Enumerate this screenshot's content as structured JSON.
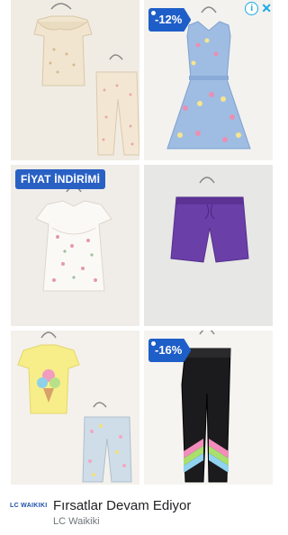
{
  "ad": {
    "tiles": [
      {
        "badge": null,
        "product": "baby blouse and pants set"
      },
      {
        "badge": "-12%",
        "product": "sleeveless printed dress"
      },
      {
        "banner": "FİYAT İNDİRİMİ",
        "product": "printed baby blouse"
      },
      {
        "badge": null,
        "product": "purple shorts"
      },
      {
        "badge": null,
        "product": "t-shirt and pants set"
      },
      {
        "badge": "-16%",
        "product": "black leggings with rainbow stripes"
      }
    ],
    "headline": "Fırsatlar Devam Ediyor",
    "advertiser": "LC Waikiki",
    "logo_text": "LC WAIKIKI",
    "info_icon": "i",
    "close_icon": "✕"
  },
  "colors": {
    "badge_bg": "#1e5ec8",
    "adchoices": "#16a9e6"
  }
}
